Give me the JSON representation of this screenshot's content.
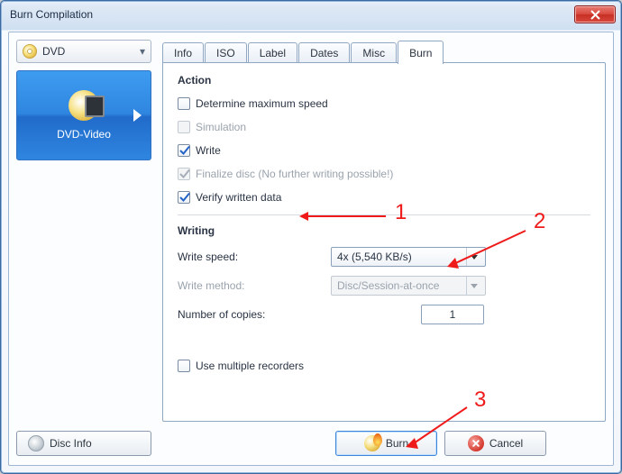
{
  "window": {
    "title": "Burn Compilation"
  },
  "media": {
    "label": "DVD"
  },
  "compilation": {
    "name": "DVD-Video"
  },
  "tabs": [
    "Info",
    "ISO",
    "Label",
    "Dates",
    "Misc",
    "Burn"
  ],
  "active_tab": "Burn",
  "sections": {
    "action": "Action",
    "writing": "Writing"
  },
  "options": {
    "determine_max_speed": "Determine maximum speed",
    "simulation": "Simulation",
    "write": "Write",
    "finalize": "Finalize disc (No further writing possible!)",
    "verify": "Verify written data",
    "use_multi": "Use multiple recorders"
  },
  "fields": {
    "write_speed_label": "Write speed:",
    "write_speed_value": "4x (5,540 KB/s)",
    "write_method_label": "Write method:",
    "write_method_value": "Disc/Session-at-once",
    "copies_label": "Number of copies:",
    "copies_value": "1"
  },
  "buttons": {
    "disc_info": "Disc Info",
    "burn": "Burn",
    "cancel": "Cancel"
  },
  "annotations": {
    "n1": "1",
    "n2": "2",
    "n3": "3"
  }
}
